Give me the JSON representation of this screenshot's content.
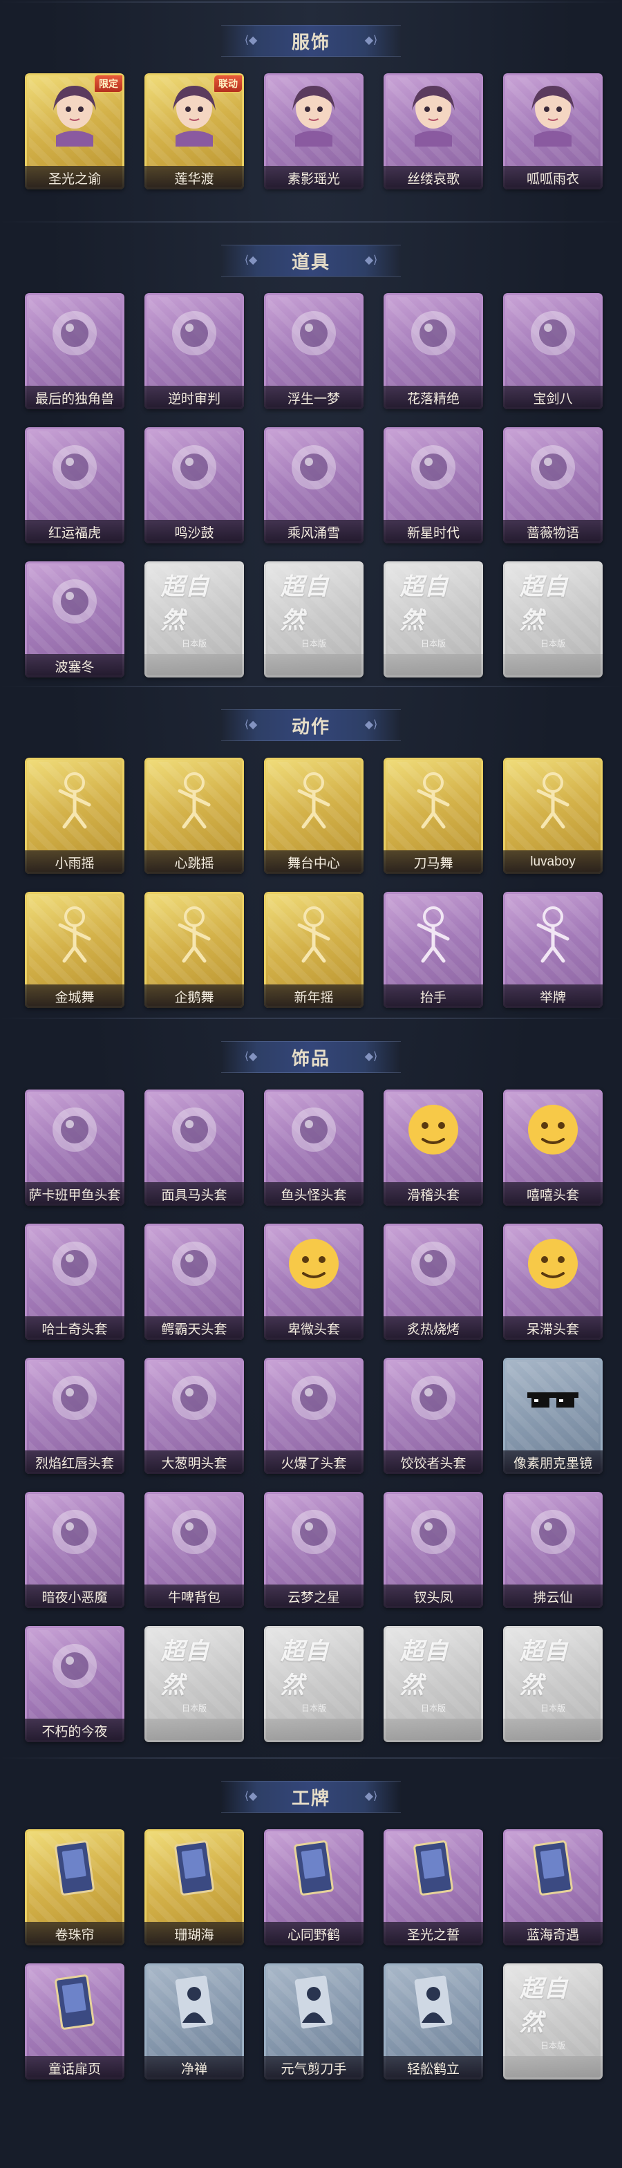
{
  "sections": [
    {
      "title": "服饰",
      "items": [
        {
          "label": "圣光之谕",
          "rarity": "gold",
          "icon": "character-portrait-icon",
          "badge": "限定"
        },
        {
          "label": "莲华渡",
          "rarity": "gold",
          "icon": "character-portrait-icon",
          "badge": "联动"
        },
        {
          "label": "素影瑶光",
          "rarity": "purple",
          "icon": "character-portrait-icon"
        },
        {
          "label": "丝缕哀歌",
          "rarity": "purple",
          "icon": "character-portrait-icon"
        },
        {
          "label": "呱呱雨衣",
          "rarity": "purple",
          "icon": "character-portrait-icon"
        }
      ]
    },
    {
      "title": "道具",
      "items": [
        {
          "label": "最后的独角兽",
          "rarity": "purple",
          "icon": "unicorn-horn-icon"
        },
        {
          "label": "逆时审判",
          "rarity": "purple",
          "icon": "pocket-watch-icon"
        },
        {
          "label": "浮生一梦",
          "rarity": "purple",
          "icon": "hourglass-icon"
        },
        {
          "label": "花落精绝",
          "rarity": "purple",
          "icon": "flower-pendant-icon"
        },
        {
          "label": "宝剑八",
          "rarity": "purple",
          "icon": "heart-locket-icon"
        },
        {
          "label": "红运福虎",
          "rarity": "purple",
          "icon": "tiger-icon"
        },
        {
          "label": "鸣沙鼓",
          "rarity": "purple",
          "icon": "drum-icon"
        },
        {
          "label": "乘风涌雪",
          "rarity": "purple",
          "icon": "snow-crystal-icon"
        },
        {
          "label": "新星时代",
          "rarity": "purple",
          "icon": "revolver-icon"
        },
        {
          "label": "蔷薇物语",
          "rarity": "purple",
          "icon": "medical-case-icon"
        },
        {
          "label": "波塞冬",
          "rarity": "purple",
          "icon": "trident-icon"
        },
        {
          "label": "",
          "rarity": "grey",
          "icon": "placeholder-logo"
        },
        {
          "label": "",
          "rarity": "grey",
          "icon": "placeholder-logo"
        },
        {
          "label": "",
          "rarity": "grey",
          "icon": "placeholder-logo"
        },
        {
          "label": "",
          "rarity": "grey",
          "icon": "placeholder-logo"
        }
      ]
    },
    {
      "title": "动作",
      "items": [
        {
          "label": "小雨摇",
          "rarity": "gold",
          "icon": "emote-pose-icon"
        },
        {
          "label": "心跳摇",
          "rarity": "gold",
          "icon": "emote-pose-icon"
        },
        {
          "label": "舞台中心",
          "rarity": "gold",
          "icon": "emote-pose-icon"
        },
        {
          "label": "刀马舞",
          "rarity": "gold",
          "icon": "emote-pose-icon"
        },
        {
          "label": "luvaboy",
          "rarity": "gold",
          "icon": "emote-pose-icon"
        },
        {
          "label": "金城舞",
          "rarity": "gold",
          "icon": "emote-pose-icon"
        },
        {
          "label": "企鹅舞",
          "rarity": "gold",
          "icon": "emote-pose-icon"
        },
        {
          "label": "新年摇",
          "rarity": "gold",
          "icon": "emote-pose-icon"
        },
        {
          "label": "抬手",
          "rarity": "purple",
          "icon": "emote-pose-icon"
        },
        {
          "label": "举牌",
          "rarity": "purple",
          "icon": "emote-pose-icon"
        }
      ]
    },
    {
      "title": "饰品",
      "items": [
        {
          "label": "萨卡班甲鱼头套",
          "rarity": "purple",
          "icon": "fish-head-icon"
        },
        {
          "label": "面具马头套",
          "rarity": "purple",
          "icon": "horse-head-icon"
        },
        {
          "label": "鱼头怪头套",
          "rarity": "purple",
          "icon": "fish-monster-icon"
        },
        {
          "label": "滑稽头套",
          "rarity": "purple",
          "icon": "emoji-face-icon"
        },
        {
          "label": "嘻嘻头套",
          "rarity": "purple",
          "icon": "emoji-face-icon"
        },
        {
          "label": "哈士奇头套",
          "rarity": "purple",
          "icon": "dog-head-icon"
        },
        {
          "label": "鳄霸天头套",
          "rarity": "purple",
          "icon": "crocodile-head-icon"
        },
        {
          "label": "卑微头套",
          "rarity": "purple",
          "icon": "emoji-face-icon"
        },
        {
          "label": "炙热烧烤",
          "rarity": "purple",
          "icon": "toast-head-icon"
        },
        {
          "label": "呆滞头套",
          "rarity": "purple",
          "icon": "emoji-face-icon"
        },
        {
          "label": "烈焰红唇头套",
          "rarity": "purple",
          "icon": "pikachu-head-icon"
        },
        {
          "label": "大葱明头套",
          "rarity": "purple",
          "icon": "scallion-head-icon"
        },
        {
          "label": "火爆了头套",
          "rarity": "purple",
          "icon": "fire-spirit-icon"
        },
        {
          "label": "饺饺者头套",
          "rarity": "purple",
          "icon": "dumpling-head-icon"
        },
        {
          "label": "像素朋克墨镜",
          "rarity": "blue",
          "icon": "pixel-sunglasses-icon"
        },
        {
          "label": "暗夜小恶魔",
          "rarity": "purple",
          "icon": "devil-doll-icon"
        },
        {
          "label": "牛啤背包",
          "rarity": "purple",
          "icon": "cow-backpack-icon"
        },
        {
          "label": "云梦之星",
          "rarity": "purple",
          "icon": "unicorn-cloud-icon"
        },
        {
          "label": "钗头凤",
          "rarity": "purple",
          "icon": "phoenix-hairpin-icon"
        },
        {
          "label": "拂云仙",
          "rarity": "purple",
          "icon": "fairy-pendant-icon"
        },
        {
          "label": "不朽的今夜",
          "rarity": "purple",
          "icon": "rose-glass-icon"
        },
        {
          "label": "",
          "rarity": "grey",
          "icon": "placeholder-logo"
        },
        {
          "label": "",
          "rarity": "grey",
          "icon": "placeholder-logo"
        },
        {
          "label": "",
          "rarity": "grey",
          "icon": "placeholder-logo"
        },
        {
          "label": "",
          "rarity": "grey",
          "icon": "placeholder-logo"
        }
      ]
    },
    {
      "title": "工牌",
      "items": [
        {
          "label": "卷珠帘",
          "rarity": "gold",
          "icon": "badge-card-icon"
        },
        {
          "label": "珊瑚海",
          "rarity": "gold",
          "icon": "badge-card-icon"
        },
        {
          "label": "心同野鹤",
          "rarity": "purple",
          "icon": "badge-card-icon"
        },
        {
          "label": "圣光之誓",
          "rarity": "purple",
          "icon": "badge-card-icon"
        },
        {
          "label": "蓝海奇遇",
          "rarity": "purple",
          "icon": "badge-card-icon"
        },
        {
          "label": "童话扉页",
          "rarity": "purple",
          "icon": "badge-card-icon"
        },
        {
          "label": "净禅",
          "rarity": "blue",
          "icon": "silhouette-card-icon"
        },
        {
          "label": "元气剪刀手",
          "rarity": "blue",
          "icon": "silhouette-card-icon"
        },
        {
          "label": "轻舩鹤立",
          "rarity": "blue",
          "icon": "silhouette-card-icon"
        },
        {
          "label": "",
          "rarity": "grey",
          "icon": "placeholder-logo"
        }
      ]
    }
  ],
  "placeholder": {
    "logo_text": "超自然",
    "sub_text": "日本版"
  },
  "colors": {
    "background": "#171d2a",
    "header": "#34467a",
    "gold": "#d4b24a",
    "purple": "#a47bb9",
    "grey": "#c9c9c9",
    "blue": "#8799ae"
  }
}
